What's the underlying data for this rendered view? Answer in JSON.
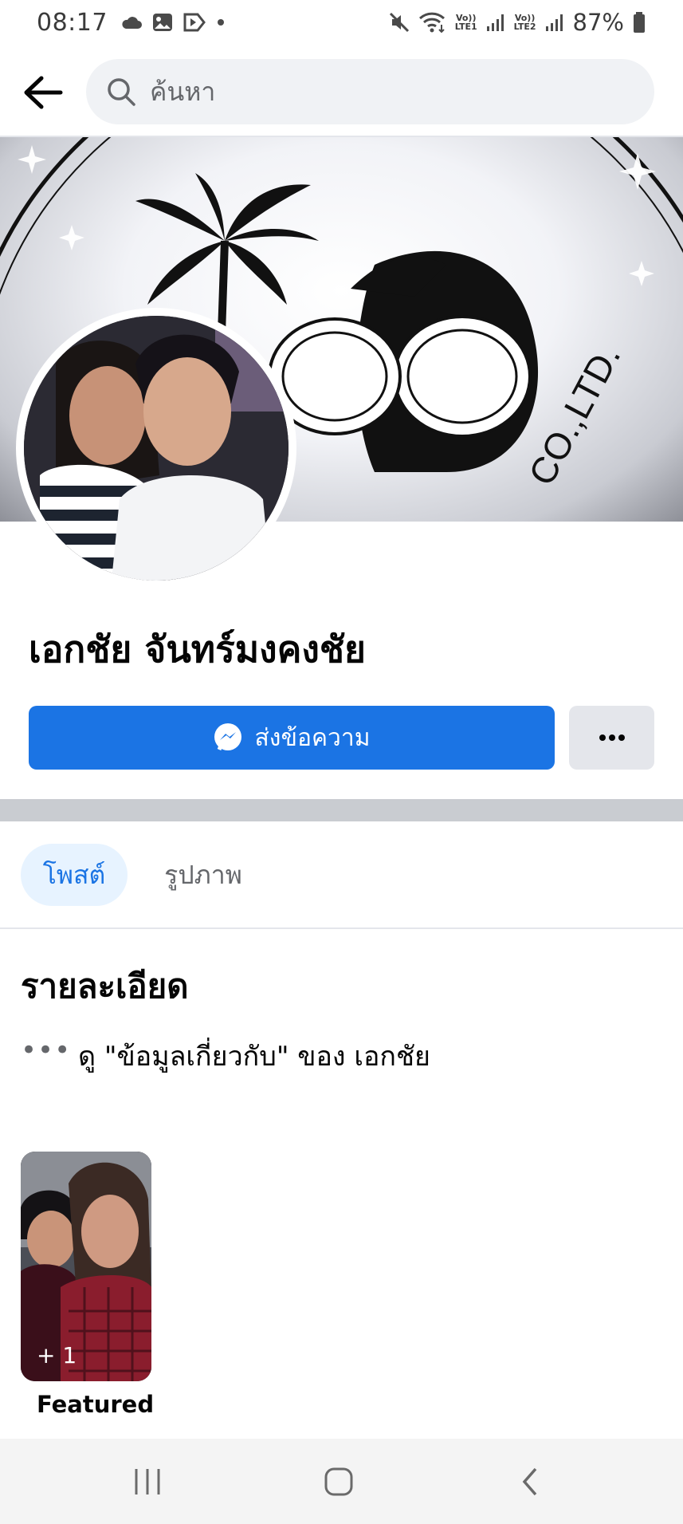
{
  "status_bar": {
    "time": "08:17",
    "battery": "87%",
    "sim1": "Vo)) LTE1",
    "sim2": "Vo)) LTE2",
    "sim1_top": "Vo))",
    "sim1_bottom": "LTE1",
    "sim2_top": "Vo))",
    "sim2_bottom": "LTE2"
  },
  "search": {
    "placeholder": "ค้นหา"
  },
  "cover": {
    "description_icons": [
      "palm-tree",
      "coconut"
    ],
    "text_ltd": "CO.,LTD."
  },
  "profile": {
    "name": "เอกชัย จันทร์มงคงชัย"
  },
  "actions": {
    "message_label": "ส่งข้อความ",
    "more_label": "···"
  },
  "tabs": [
    {
      "label": "โพสต์",
      "active": true
    },
    {
      "label": "รูปภาพ",
      "active": false
    }
  ],
  "details": {
    "title": "รายละเอียด",
    "about_dots": "•••",
    "about_text": "ดู \"ข้อมูลเกี่ยวกับ\" ของ เอกชัย"
  },
  "featured": {
    "count": "+ 1",
    "label": "Featured"
  },
  "colors": {
    "accent": "#1b74e4",
    "tab_active_bg": "#e7f3ff",
    "secondary_text": "#65676b",
    "button_grey": "#e4e6eb"
  }
}
